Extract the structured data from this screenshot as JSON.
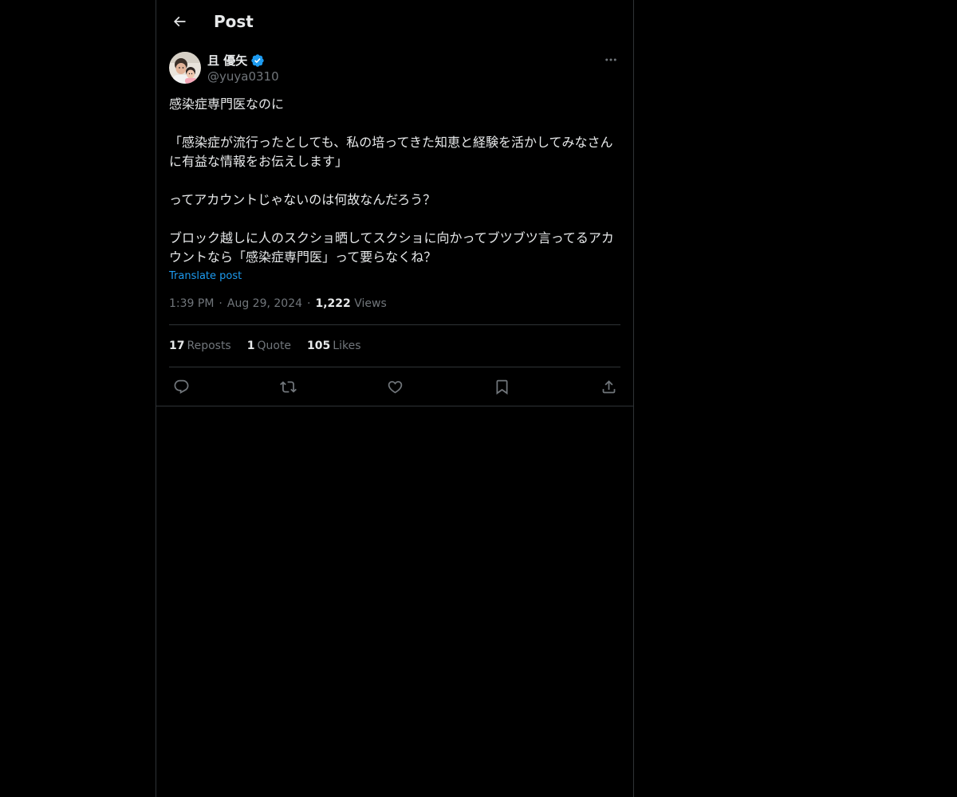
{
  "header": {
    "title": "Post",
    "back_icon": "arrow-left-icon"
  },
  "tweet": {
    "author": {
      "name": "且 優矢",
      "handle": "@yuya0310",
      "verified": true,
      "verified_color": "#1d9bf0"
    },
    "more_icon": "ellipsis-icon",
    "text": "感染症専門医なのに\n\n「感染症が流行ったとしても、私の培ってきた知恵と経験を活かしてみなさんに有益な情報をお伝えします」\n\nってアカウントじゃないのは何故なんだろう？\n\nブロック越しに人のスクショ晒してスクショに向かってブツブツ言ってるアカウントなら「感染症専門医」って要らなくね？",
    "translate_label": "Translate post",
    "time": "1:39 PM",
    "date": "Aug 29, 2024",
    "views_count": "1,222",
    "views_label": "Views",
    "stats": {
      "reposts_count": "17",
      "reposts_label": "Reposts",
      "quotes_count": "1",
      "quotes_label": "Quote",
      "likes_count": "105",
      "likes_label": "Likes"
    },
    "actions": [
      "reply-icon",
      "repost-icon",
      "like-icon",
      "bookmark-icon",
      "share-icon"
    ]
  },
  "colors": {
    "background": "#000000",
    "text_primary": "#e7e9ea",
    "text_secondary": "#71767b",
    "border": "#2f3336",
    "accent": "#1d9bf0"
  }
}
